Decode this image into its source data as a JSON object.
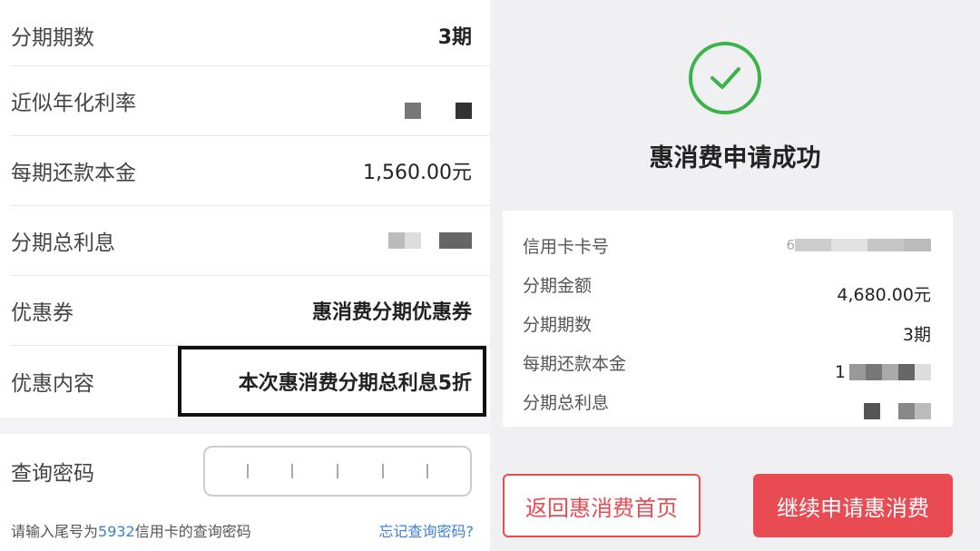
{
  "left_panel": {
    "rows": [
      {
        "label": "分期期数",
        "value": "3期"
      },
      {
        "label": "近似年化利率",
        "value": ""
      },
      {
        "label": "每期还款本金",
        "value": "1,560.00元"
      },
      {
        "label": "分期总利息",
        "value": ""
      },
      {
        "label": "优惠券",
        "value": "惠消费分期优惠券"
      },
      {
        "label": "优惠内容",
        "value": "本次惠消费分期总利息5折"
      }
    ],
    "password": {
      "label": "查询密码"
    },
    "hint": {
      "prefix": "请输入尾号为",
      "card_tail": "5932",
      "suffix": "信用卡的查询密码",
      "forgot": "忘记查询密码?"
    }
  },
  "right_panel": {
    "success_title": "惠消费申请成功",
    "details": [
      {
        "label": "信用卡卡号",
        "value": "6"
      },
      {
        "label": "分期金额",
        "value": "4,680.00元"
      },
      {
        "label": "分期期数",
        "value": "3期"
      },
      {
        "label": "每期还款本金",
        "value": "1"
      },
      {
        "label": "分期总利息",
        "value": ""
      }
    ],
    "buttons": {
      "back": "返回惠消费首页",
      "continue": "继续申请惠消费"
    }
  },
  "colors": {
    "accent_red": "#e94b53",
    "success_green": "#3cb24a",
    "link_blue": "#3b7fd6"
  },
  "icons": {
    "success": "check-circle-icon"
  }
}
